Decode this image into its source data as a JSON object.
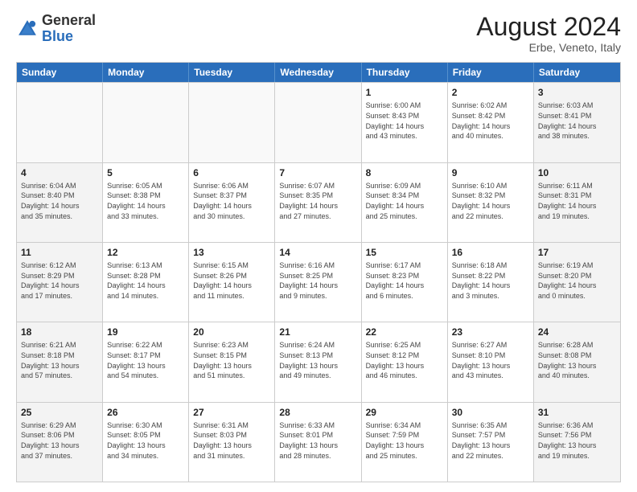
{
  "header": {
    "logo_general": "General",
    "logo_blue": "Blue",
    "month_year": "August 2024",
    "location": "Erbe, Veneto, Italy"
  },
  "calendar": {
    "days_of_week": [
      "Sunday",
      "Monday",
      "Tuesday",
      "Wednesday",
      "Thursday",
      "Friday",
      "Saturday"
    ],
    "weeks": [
      [
        {
          "day": "",
          "info": "",
          "empty": true
        },
        {
          "day": "",
          "info": "",
          "empty": true
        },
        {
          "day": "",
          "info": "",
          "empty": true
        },
        {
          "day": "",
          "info": "",
          "empty": true
        },
        {
          "day": "1",
          "info": "Sunrise: 6:00 AM\nSunset: 8:43 PM\nDaylight: 14 hours\nand 43 minutes."
        },
        {
          "day": "2",
          "info": "Sunrise: 6:02 AM\nSunset: 8:42 PM\nDaylight: 14 hours\nand 40 minutes."
        },
        {
          "day": "3",
          "info": "Sunrise: 6:03 AM\nSunset: 8:41 PM\nDaylight: 14 hours\nand 38 minutes."
        }
      ],
      [
        {
          "day": "4",
          "info": "Sunrise: 6:04 AM\nSunset: 8:40 PM\nDaylight: 14 hours\nand 35 minutes."
        },
        {
          "day": "5",
          "info": "Sunrise: 6:05 AM\nSunset: 8:38 PM\nDaylight: 14 hours\nand 33 minutes."
        },
        {
          "day": "6",
          "info": "Sunrise: 6:06 AM\nSunset: 8:37 PM\nDaylight: 14 hours\nand 30 minutes."
        },
        {
          "day": "7",
          "info": "Sunrise: 6:07 AM\nSunset: 8:35 PM\nDaylight: 14 hours\nand 27 minutes."
        },
        {
          "day": "8",
          "info": "Sunrise: 6:09 AM\nSunset: 8:34 PM\nDaylight: 14 hours\nand 25 minutes."
        },
        {
          "day": "9",
          "info": "Sunrise: 6:10 AM\nSunset: 8:32 PM\nDaylight: 14 hours\nand 22 minutes."
        },
        {
          "day": "10",
          "info": "Sunrise: 6:11 AM\nSunset: 8:31 PM\nDaylight: 14 hours\nand 19 minutes."
        }
      ],
      [
        {
          "day": "11",
          "info": "Sunrise: 6:12 AM\nSunset: 8:29 PM\nDaylight: 14 hours\nand 17 minutes."
        },
        {
          "day": "12",
          "info": "Sunrise: 6:13 AM\nSunset: 8:28 PM\nDaylight: 14 hours\nand 14 minutes."
        },
        {
          "day": "13",
          "info": "Sunrise: 6:15 AM\nSunset: 8:26 PM\nDaylight: 14 hours\nand 11 minutes."
        },
        {
          "day": "14",
          "info": "Sunrise: 6:16 AM\nSunset: 8:25 PM\nDaylight: 14 hours\nand 9 minutes."
        },
        {
          "day": "15",
          "info": "Sunrise: 6:17 AM\nSunset: 8:23 PM\nDaylight: 14 hours\nand 6 minutes."
        },
        {
          "day": "16",
          "info": "Sunrise: 6:18 AM\nSunset: 8:22 PM\nDaylight: 14 hours\nand 3 minutes."
        },
        {
          "day": "17",
          "info": "Sunrise: 6:19 AM\nSunset: 8:20 PM\nDaylight: 14 hours\nand 0 minutes."
        }
      ],
      [
        {
          "day": "18",
          "info": "Sunrise: 6:21 AM\nSunset: 8:18 PM\nDaylight: 13 hours\nand 57 minutes."
        },
        {
          "day": "19",
          "info": "Sunrise: 6:22 AM\nSunset: 8:17 PM\nDaylight: 13 hours\nand 54 minutes."
        },
        {
          "day": "20",
          "info": "Sunrise: 6:23 AM\nSunset: 8:15 PM\nDaylight: 13 hours\nand 51 minutes."
        },
        {
          "day": "21",
          "info": "Sunrise: 6:24 AM\nSunset: 8:13 PM\nDaylight: 13 hours\nand 49 minutes."
        },
        {
          "day": "22",
          "info": "Sunrise: 6:25 AM\nSunset: 8:12 PM\nDaylight: 13 hours\nand 46 minutes."
        },
        {
          "day": "23",
          "info": "Sunrise: 6:27 AM\nSunset: 8:10 PM\nDaylight: 13 hours\nand 43 minutes."
        },
        {
          "day": "24",
          "info": "Sunrise: 6:28 AM\nSunset: 8:08 PM\nDaylight: 13 hours\nand 40 minutes."
        }
      ],
      [
        {
          "day": "25",
          "info": "Sunrise: 6:29 AM\nSunset: 8:06 PM\nDaylight: 13 hours\nand 37 minutes."
        },
        {
          "day": "26",
          "info": "Sunrise: 6:30 AM\nSunset: 8:05 PM\nDaylight: 13 hours\nand 34 minutes."
        },
        {
          "day": "27",
          "info": "Sunrise: 6:31 AM\nSunset: 8:03 PM\nDaylight: 13 hours\nand 31 minutes."
        },
        {
          "day": "28",
          "info": "Sunrise: 6:33 AM\nSunset: 8:01 PM\nDaylight: 13 hours\nand 28 minutes."
        },
        {
          "day": "29",
          "info": "Sunrise: 6:34 AM\nSunset: 7:59 PM\nDaylight: 13 hours\nand 25 minutes."
        },
        {
          "day": "30",
          "info": "Sunrise: 6:35 AM\nSunset: 7:57 PM\nDaylight: 13 hours\nand 22 minutes."
        },
        {
          "day": "31",
          "info": "Sunrise: 6:36 AM\nSunset: 7:56 PM\nDaylight: 13 hours\nand 19 minutes."
        }
      ]
    ]
  }
}
